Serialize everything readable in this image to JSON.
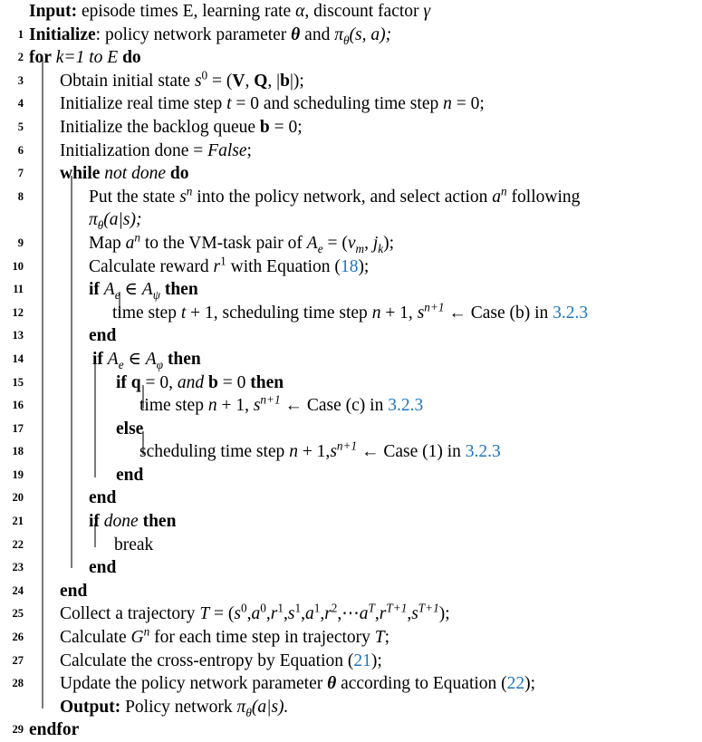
{
  "document": {
    "type": "algorithm-pseudocode",
    "title": "Policy gradient VM-task scheduling training loop",
    "reference_color": "#2176bd",
    "text_color": "#000000",
    "background_color": "#ffffff"
  },
  "keywords": {
    "input": "Input:",
    "output": "Output:",
    "initialize": "Initialize",
    "for": "for",
    "do": "do",
    "while": "while",
    "if": "if",
    "then": "then",
    "else": "else",
    "end": "end",
    "endfor": "endfor",
    "break": "break",
    "and": "and",
    "not": "not",
    "done": "done",
    "false": "False"
  },
  "lines": [
    {
      "num": "",
      "indent": 0,
      "text": "Input: episode times E, learning rate α, discount factor γ"
    },
    {
      "num": "1",
      "indent": 0,
      "text": "Initialize: policy network parameter θ and πθ(s, a);"
    },
    {
      "num": "2",
      "indent": 0,
      "text": "for k=1 to E do"
    },
    {
      "num": "3",
      "indent": 1,
      "text": "Obtain initial state s0 = (V, Q, |b|);"
    },
    {
      "num": "4",
      "indent": 1,
      "text": "Initialize real time step t = 0 and scheduling time step n = 0;"
    },
    {
      "num": "5",
      "indent": 1,
      "text": "Initialize the backlog queue b = 0;"
    },
    {
      "num": "6",
      "indent": 1,
      "text": "Initialization done = False;"
    },
    {
      "num": "7",
      "indent": 1,
      "text": "while not done do"
    },
    {
      "num": "8",
      "indent": 2,
      "text": "Put the state sn into the policy network, and select action an following πθ(a|s);"
    },
    {
      "num": "9",
      "indent": 2,
      "text": "Map an to the VM-task pair of Ae = (vm, jk);"
    },
    {
      "num": "10",
      "indent": 2,
      "text": "Calculate reward r1 with Equation (18);"
    },
    {
      "num": "11",
      "indent": 2,
      "text": "if Ae ∈ Aψ then"
    },
    {
      "num": "12",
      "indent": 3,
      "text": "time step t + 1, scheduling time step n + 1, sn+1 ← Case (b) in 3.2.3"
    },
    {
      "num": "13",
      "indent": 2,
      "text": "end"
    },
    {
      "num": "14",
      "indent": 2,
      "text": "if Ae ∈ Aφ then"
    },
    {
      "num": "15",
      "indent": 3,
      "text": "if q = 0, and b = 0 then"
    },
    {
      "num": "16",
      "indent": 4,
      "text": "time step n + 1, sn+1 ← Case (c) in 3.2.3"
    },
    {
      "num": "17",
      "indent": 3,
      "text": "else"
    },
    {
      "num": "18",
      "indent": 4,
      "text": "scheduling time step n + 1,sn+1 ← Case (1) in 3.2.3"
    },
    {
      "num": "19",
      "indent": 3,
      "text": "end"
    },
    {
      "num": "20",
      "indent": 2,
      "text": "end"
    },
    {
      "num": "21",
      "indent": 2,
      "text": "if done then"
    },
    {
      "num": "22",
      "indent": 3,
      "text": "break"
    },
    {
      "num": "23",
      "indent": 2,
      "text": "end"
    },
    {
      "num": "24",
      "indent": 1,
      "text": "end"
    },
    {
      "num": "25",
      "indent": 1,
      "text": "Collect a trajectory T = (s0,a0,r1,s1,a1,r2,⋯aT,rT+1,sT+1);"
    },
    {
      "num": "26",
      "indent": 1,
      "text": "Calculate Gn for each time step in trajectory T;"
    },
    {
      "num": "27",
      "indent": 1,
      "text": "Calculate the cross-entropy by Equation (21);"
    },
    {
      "num": "28",
      "indent": 1,
      "text": "Update the policy network parameter θ according to Equation (22);"
    },
    {
      "num": "",
      "indent": 1,
      "text": "Output: Policy network πθ(a|s)."
    },
    {
      "num": "29",
      "indent": 0,
      "text": "endfor"
    }
  ],
  "line_numbers": {
    "n1": "1",
    "n2": "2",
    "n3": "3",
    "n4": "4",
    "n5": "5",
    "n6": "6",
    "n7": "7",
    "n8": "8",
    "n9": "9",
    "n10": "10",
    "n11": "11",
    "n12": "12",
    "n13": "13",
    "n14": "14",
    "n15": "15",
    "n16": "16",
    "n17": "17",
    "n18": "18",
    "n19": "19",
    "n20": "20",
    "n21": "21",
    "n22": "22",
    "n23": "23",
    "n24": "24",
    "n25": "25",
    "n26": "26",
    "n27": "27",
    "n28": "28",
    "n29": "29",
    "blank": ""
  },
  "tokens": {
    "input_label": "Input:",
    "input_rest_a": " episode times E, learning rate ",
    "alpha": "α",
    "input_rest_b": ", discount factor ",
    "gamma": "γ",
    "initialize_label": "Initialize",
    "init_colon": ": policy network parameter ",
    "theta_bold": "θ",
    "init_and": " and ",
    "pi": "π",
    "theta_sub": "θ",
    "init_args": "(s, a);",
    "for_kw": "for",
    "for_k": "k=1",
    "for_to": "to",
    "for_E": "E",
    "do_kw": "do",
    "l3_a": "Obtain initial state ",
    "l3_s": "s",
    "l3_sup0": "0",
    "l3_eq": " = (",
    "l3_V": "V",
    "l3_comma1": ", ",
    "l3_Q": "Q",
    "l3_comma2": ", |",
    "l3_b": "b",
    "l3_end": "|);",
    "l4_a": "Initialize real time step ",
    "l4_t": "t",
    "l4_eq0": " = 0 and scheduling time step ",
    "l4_n": "n",
    "l4_end": " = 0;",
    "l5_a": "Initialize the backlog queue ",
    "l5_b": "b",
    "l5_end": " = 0;",
    "l6_a": "Initialization done = ",
    "l6_false": "False",
    "l6_end": ";",
    "while_kw": "while",
    "not_kw": "not",
    "done_kw": "done",
    "l8_a": "Put the state ",
    "l8_s": "s",
    "l8_supn": "n",
    "l8_b": " into the policy network, and select action ",
    "l8_a2": "a",
    "l8_supn2": "n",
    "l8_c": " following",
    "l8_pi": "π",
    "l8_subtheta": "θ",
    "l8_args": "(a|s);",
    "l9_a": "Map ",
    "l9_an": "a",
    "l9_supn": "n",
    "l9_b": " to the VM-task pair of ",
    "l9_A": "A",
    "l9_sube": "e",
    "l9_eq": " = (",
    "l9_v": "v",
    "l9_subm": "m",
    "l9_comma": ", ",
    "l9_j": "j",
    "l9_subk": "k",
    "l9_end": ");",
    "l10_a": "Calculate reward ",
    "l10_r": "r",
    "l10_sup1": "1",
    "l10_b": " with Equation (",
    "l10_ref": "18",
    "l10_end": ");",
    "if_kw": "if",
    "then_kw": "then",
    "l11_A": "A",
    "l11_sube": "e",
    "l11_in": " ∈ ",
    "l11_A2": "A",
    "l11_psi": "ψ",
    "l12_a": "time step ",
    "l12_t": "t",
    "l12_plus": " + 1, scheduling time step ",
    "l12_n": "n",
    "l12_plus2": " + 1, ",
    "l12_s": "s",
    "l12_supn1": "n+1",
    "l12_arrow": " ← Case (b) in ",
    "l12_ref": "3.2.3",
    "end_kw": "end",
    "l14_A": "A",
    "l14_sube": "e",
    "l14_in": " ∈ ",
    "l14_A2": "A",
    "l14_phi": "φ",
    "l15_q": "q",
    "l15_eq": " = 0, ",
    "l15_and": "and",
    "l15_b": "b",
    "l15_eq2": " = 0 ",
    "l16_a": "time step ",
    "l16_n": "n",
    "l16_plus": " + 1, ",
    "l16_s": "s",
    "l16_supn1": "n+1",
    "l16_arrow": " ← Case (c) in ",
    "l16_ref": "3.2.3",
    "else_kw": "else",
    "l18_a": "scheduling time step ",
    "l18_n": "n",
    "l18_plus": " + 1,",
    "l18_s": "s",
    "l18_supn1": "n+1",
    "l18_arrow": " ← Case (1) in ",
    "l18_ref": "3.2.3",
    "break_kw": "break",
    "l25_a": "Collect a trajectory ",
    "l25_T": "T",
    "l25_eq": " = (",
    "l25_s0": "s",
    "l25_s0sup": "0",
    "l25_a0": "a",
    "l25_a0sup": "0",
    "l25_r1": "r",
    "l25_r1sup": "1",
    "l25_s1": "s",
    "l25_s1sup": "1",
    "l25_a1": "a",
    "l25_a1sup": "1",
    "l25_r2": "r",
    "l25_r2sup": "2",
    "l25_dots": "⋯",
    "l25_aT": "a",
    "l25_aTsup": "T",
    "l25_rT": "r",
    "l25_rTsup": "T+1",
    "l25_sT": "s",
    "l25_sTsup": "T+1",
    "l25_end": ");",
    "l25_comma": ",",
    "l26_a": "Calculate ",
    "l26_G": "G",
    "l26_supn": "n",
    "l26_b": " for each time step in trajectory ",
    "l26_T": "T",
    "l26_end": ";",
    "l27_a": "Calculate the cross-entropy by Equation (",
    "l27_ref": "21",
    "l27_end": ");",
    "l28_a": "Update the policy network parameter ",
    "l28_theta": "θ",
    "l28_b": " according to Equation (",
    "l28_ref": "22",
    "l28_end": ");",
    "output_label": "Output:",
    "output_a": " Policy network ",
    "output_pi": "π",
    "output_subtheta": "θ",
    "output_args": "(a|s).",
    "endfor_kw": "endfor"
  }
}
